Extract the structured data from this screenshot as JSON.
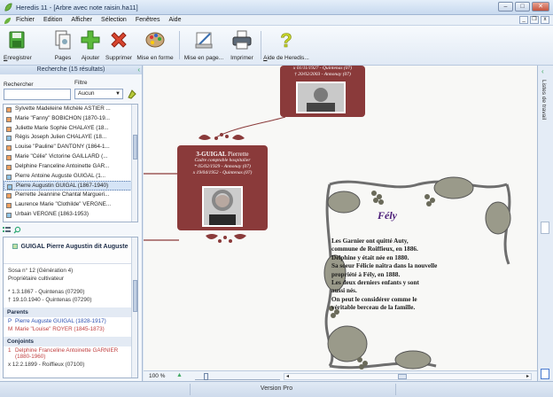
{
  "window": {
    "title": "Heredis 11 - [Arbre avec note raisin.ha11]"
  },
  "menu": [
    "Fichier",
    "Edition",
    "Afficher",
    "Sélection",
    "Fenêtres",
    "Aide"
  ],
  "toolbar": [
    {
      "label": "Enregistrer",
      "icon": "save-icon"
    },
    {
      "label": "Pages",
      "icon": "pages-icon"
    },
    {
      "label": "Ajouter",
      "icon": "add-icon"
    },
    {
      "label": "Supprimer",
      "icon": "delete-icon"
    },
    {
      "label": "Mise en forme",
      "icon": "palette-icon"
    },
    {
      "label": "Mise en page...",
      "icon": "page-setup-icon"
    },
    {
      "label": "Imprimer",
      "icon": "print-icon"
    },
    {
      "label": "Aide de Heredis...",
      "icon": "help-icon"
    }
  ],
  "left_panel": {
    "header": "Recherche (15 résultats)",
    "search_label": "Rechercher",
    "filter_label": "Filtre",
    "filter_value": "Aucun",
    "persons": [
      {
        "name": "Sylvette Madeleine Michèle ASTIER ...",
        "color": "#f0a060"
      },
      {
        "name": "Marie \"Fanny\" BOBICHON (1870-19...",
        "color": "#f0a060"
      },
      {
        "name": "Juliette Marie Sophie CHALAYE (18...",
        "color": "#f0a060"
      },
      {
        "name": "Régis Joseph Julien CHALAYE (18...",
        "color": "#8fc3e6"
      },
      {
        "name": "Louise \"Pauline\" DANTONY (1864-1...",
        "color": "#f0a060"
      },
      {
        "name": "Marie \"Célie\" Victorine GAILLARD (...",
        "color": "#f0a060"
      },
      {
        "name": "Delphine Franceline Antoinette GAR...",
        "color": "#f0a060"
      },
      {
        "name": "Pierre Antoine Auguste GUIGAL (1...",
        "color": "#8fc3e6"
      },
      {
        "name": "Pierre Augustin GUIGAL (1867-1940)",
        "color": "#8fc3e6",
        "selected": true
      },
      {
        "name": "Pierrette Jeannine Chantal Margueri...",
        "color": "#f0a060"
      },
      {
        "name": "Laurence Marie \"Clothilde\" VERGNE...",
        "color": "#f0a060"
      },
      {
        "name": "Urbain VERGNE (1863-1953)",
        "color": "#8fc3e6"
      }
    ],
    "detail": {
      "name": "GUIGAL Pierre Augustin dit Auguste",
      "sosa": "Sosa n° 12 (Génération 4)",
      "occupation": "Propriétaire cultivateur",
      "birth": "*   1.3.1867 - Quintenas (07290)",
      "death": "†   19.10.1940 - Quintenas (07290)",
      "parents_title": "Parents",
      "father": "Pierre Auguste GUIGAL (1828-1917)",
      "mother": "Marie \"Louise\" ROYER (1845-1873)",
      "father_key": "P",
      "mother_key": "M",
      "spouses_title": "Conjoints",
      "spouse_key": "1",
      "spouse": "Delphine Franceline Antoinette GARNIER (1880-1960)",
      "marriage": "x   12.2.1899 - Roiffieux (07100)"
    }
  },
  "canvas": {
    "top_card": {
      "line1": "x 01/11/1927 - Quintenas (07)",
      "line2": "† 20/02/2003 - Annonay (07)"
    },
    "card": {
      "name_prefix": "3-GUIGAL",
      "name": "Pierrette",
      "occupation": "Cadre comptable hospitalier",
      "birth": "* 05/02/1929 - Annonay (07)",
      "marriage": "x 19/04/1952 - Quintenas (07)"
    },
    "note_title": "Fély",
    "note_text": [
      "Les Garnier ont quitté Auty,",
      "commune de Roiffieux, en 1886.",
      "Delphine y était née en 1880.",
      "Sa soeur Félicie naîtra dans la nouvelle",
      "propriété à Fély, en 1888.",
      "Les deux derniers enfants y sont",
      "aussi nés.",
      "On peut le considérer comme le",
      "véritable berceau de la famille."
    ]
  },
  "right_dock": {
    "label": "Listes de travail"
  },
  "bottom": {
    "zoom": "100 %"
  },
  "status": {
    "text": "Version Pro"
  }
}
